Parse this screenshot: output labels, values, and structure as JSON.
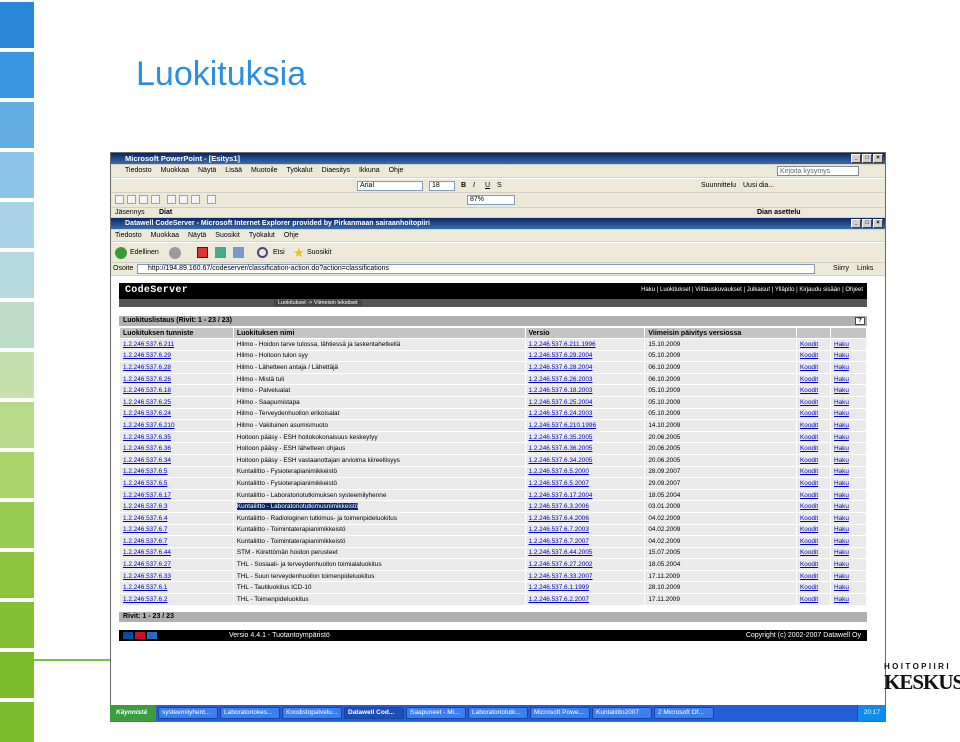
{
  "slide": {
    "title": "Luokituksia",
    "logo": {
      "line1": "HOITOPIIRI",
      "line2": "KESKUS"
    },
    "strip_colors": [
      "#2a86d8",
      "#3a96e0",
      "#64aee6",
      "#8cc4ea",
      "#a8d2e6",
      "#b4d8dc",
      "#bcdcc8",
      "#c6e0b0",
      "#b8da8c",
      "#a8d46c",
      "#98cc50",
      "#8cc43c",
      "#84c034",
      "#7cbc2c",
      "#7cbc2c"
    ]
  },
  "powerpoint": {
    "title": "Microsoft PowerPoint - [Esitys1]",
    "menu": [
      "Tiedosto",
      "Muokkaa",
      "Näytä",
      "Lisää",
      "Muotoile",
      "Työkalut",
      "Diaesitys",
      "Ikkuna",
      "Ohje"
    ],
    "help_placeholder": "Kirjoita kysymys",
    "font_name": "Arial",
    "font_size": "18",
    "zoom": "87%",
    "design_label": "Suunnittelu",
    "new_slide_label": "Uusi dia...",
    "tabs": [
      "Jäsennys",
      "Diat"
    ],
    "task_pane_title": "Dian asettelu"
  },
  "ie": {
    "title": "Datawell CodeServer - Microsoft Internet Explorer provided by Pirkanmaan sairaanhoitopiiri",
    "menu": [
      "Tiedosto",
      "Muokkaa",
      "Näytä",
      "Suosikit",
      "Työkalut",
      "Ohje"
    ],
    "back_label": "Edellinen",
    "search_label": "Etsi",
    "favorites_label": "Suosikit",
    "address_label": "Osoite",
    "url": "http://194.89.160.67/codeserver/classification-action.do?action=classifications",
    "go_label": "Siirry",
    "links_label": "Links"
  },
  "codeserver": {
    "logo": "CodeServer",
    "nav": "Haku | Luokitukset | Viittauskuvaukset | Julkaisut | Ylläpito | Kirjaudu sisään | Ohjeet",
    "breadcrumb": "Luokitukset -> Viimeisin tekstiset",
    "list_title": "Luokituslistaus (Rivit: 1 - 23 / 23)",
    "help_mark": "?",
    "columns": [
      "Luokituksen tunniste",
      "Luokituksen nimi",
      "Versio",
      "Viimeisin päivitys versiossa",
      "",
      ""
    ],
    "rows": [
      [
        "1.2.246.537.6.211",
        "Hilmo - Hoidon tarve tulossa, lähtiessä ja laskentahetkellä",
        "1.2.246.537.6.211.1996",
        "15.10.2009",
        "Koodit",
        "Haku"
      ],
      [
        "1.2.246.537.6.29",
        "Hilmo - Hoitoon tulon syy",
        "1.2.246.537.6.29.2004",
        "05.10.2009",
        "Koodit",
        "Haku"
      ],
      [
        "1.2.246.537.6.28",
        "Hilmo - Lähetteen antaja / Lähettäjä",
        "1.2.246.537.6.28.2004",
        "06.10.2009",
        "Koodit",
        "Haku"
      ],
      [
        "1.2.246.537.6.26",
        "Hilmo - Mistä tuli",
        "1.2.246.537.6.26.2003",
        "06.10.2009",
        "Koodit",
        "Haku"
      ],
      [
        "1.2.246.537.6.18",
        "Hilmo - Palvelualat",
        "1.2.246.537.6.18.2003",
        "05.10.2009",
        "Koodit",
        "Haku"
      ],
      [
        "1.2.246.537.6.25",
        "Hilmo - Saapumistapa",
        "1.2.246.537.6.25.2004",
        "05.10.2009",
        "Koodit",
        "Haku"
      ],
      [
        "1.2.246.537.6.24",
        "Hilmo - Terveydenhuollon erikoisalat",
        "1.2.246.537.6.24.2003",
        "05.10.2009",
        "Koodit",
        "Haku"
      ],
      [
        "1.2.246.537.6.210",
        "Hilmo - Vakituinen asumismuoto",
        "1.2.246.537.6.210.1996",
        "14.10.2009",
        "Koodit",
        "Haku"
      ],
      [
        "1.2.246.537.6.35",
        "Hoitoon pääsy - ESH hoitokokonaisuus keskeytyy",
        "1.2.246.537.6.35.2005",
        "20.06.2005",
        "Koodit",
        "Haku"
      ],
      [
        "1.2.246.537.6.36",
        "Hoitoon pääsy - ESH lähetteen ohjaus",
        "1.2.246.537.6.36.2005",
        "20.06.2005",
        "Koodit",
        "Haku"
      ],
      [
        "1.2.246.537.6.34",
        "Hoitoon pääsy - ESH vastaanottajan arvioima kiireellisyys",
        "1.2.246.537.6.34.2005",
        "20.06.2005",
        "Koodit",
        "Haku"
      ],
      [
        "1.2.246.537.6.5",
        "Kuntaliitto - Fysioterapianimikkeistö",
        "1.2.246.537.6.5.2000",
        "28.09.2007",
        "Koodit",
        "Haku"
      ],
      [
        "1.2.246.537.6.5",
        "Kuntaliitto - Fysioterapianimikkeistö",
        "1.2.246.537.6.5.2007",
        "29.09.2007",
        "Koodit",
        "Haku"
      ],
      [
        "1.2.246.537.6.17",
        "Kuntaliitto - Laboratoriotutkimuksen systeemilyhenne",
        "1.2.246.537.6.17.2004",
        "18.05.2004",
        "Koodit",
        "Haku"
      ],
      [
        "1.2.246.537.6.3",
        "Kuntaliitto - Laboratoriotutkimusnimikkeistö",
        "1.2.246.537.6.3.2006",
        "03.01.2009",
        "Koodit",
        "Haku"
      ],
      [
        "1.2.246.537.6.4",
        "Kuntaliitto - Radiologinen tutkimus- ja toimenpideluokitus",
        "1.2.246.537.6.4.2006",
        "04.02.2009",
        "Koodit",
        "Haku"
      ],
      [
        "1.2.246.537.6.7",
        "Kuntaliitto - Toimintaterapianimikkeistö",
        "1.2.246.537.6.7.2003",
        "04.02.2009",
        "Koodit",
        "Haku"
      ],
      [
        "1.2.246.537.6.7",
        "Kuntaliitto - Toimintaterapianimikkeistö",
        "1.2.246.537.6.7.2007",
        "04.02.2009",
        "Koodit",
        "Haku"
      ],
      [
        "1.2.246.537.6.44",
        "STM - Kiirettömän hoidon perusteet",
        "1.2.246.537.6.44.2005",
        "15.07.2005",
        "Koodit",
        "Haku"
      ],
      [
        "1.2.246.537.6.27",
        "THL - Sosiaali- ja terveydenhuollon toimialaluokitus",
        "1.2.246.537.6.27.2002",
        "18.05.2004",
        "Koodit",
        "Haku"
      ],
      [
        "1.2.246.537.6.33",
        "THL - Suun terveydenhuollon toimenpideluokitus",
        "1.2.246.537.6.33.2007",
        "17.11.2009",
        "Koodit",
        "Haku"
      ],
      [
        "1.2.246.537.6.1",
        "THL - Tautiluokitus ICD-10",
        "1.2.246.537.6.1.1999",
        "28.10.2009",
        "Koodit",
        "Haku"
      ],
      [
        "1.2.246.537.6.2",
        "THL - Toimenpideluokitus",
        "1.2.246.537.6.2.2007",
        "17.11.2009",
        "Koodit",
        "Haku"
      ]
    ],
    "selected_row": 14,
    "rows_footer": "Rivit: 1 - 23 / 23",
    "version": "Versio 4.4.1 - Tuotantoympäristö",
    "copyright": "Copyright (c) 2002-2007 Datawell Oy"
  },
  "taskbar": {
    "start": "Käynnistä",
    "tasks": [
      "systeemilyhent...",
      "Laboratoriokes...",
      "Koodistopalvelu...",
      "Datawell Cod...",
      "Saapuneet - Mi...",
      "Laboratoriotutk...",
      "Microsoft Powe...",
      "Kuntaliitto2007",
      "2 Microsoft Of..."
    ],
    "active_task": 3,
    "clock": "20:17"
  }
}
